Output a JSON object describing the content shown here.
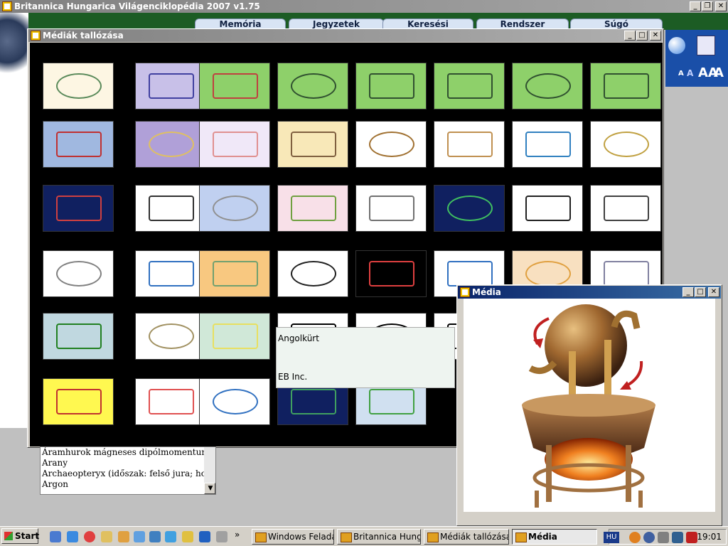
{
  "app": {
    "title": "Britannica Hungarica Világenciklopédia 2007 v1.75",
    "menu": [
      "Memória",
      "Jegyzetek",
      "Keresési beállítások",
      "Rendszer",
      "Súgó"
    ],
    "font_buttons": [
      "A",
      "A",
      "AA",
      "A"
    ]
  },
  "browser_window": {
    "title": "Médiák tallózása",
    "tooltip": {
      "name": "Angolkürt",
      "credit": "EB Inc."
    }
  },
  "thumbnails": [
    {
      "bg": "#fdf6e3",
      "mark": "#5a8a5a"
    },
    {
      "bg": "#c8c0e8",
      "mark": "#4040a0"
    },
    {
      "bg": "#8ed06a",
      "mark": "#c04040"
    },
    {
      "bg": "#8ed06a",
      "mark": "#305030"
    },
    {
      "bg": "#8ed06a",
      "mark": "#305030"
    },
    {
      "bg": "#8ed06a",
      "mark": "#305030"
    },
    {
      "bg": "#8ed06a",
      "mark": "#305030"
    },
    {
      "bg": "#8ed06a",
      "mark": "#305030"
    },
    {
      "bg": "#a0b8e0",
      "mark": "#c03030"
    },
    {
      "bg": "#b0a0d8",
      "mark": "#e0c060"
    },
    {
      "bg": "#f0e8f8",
      "mark": "#e09090"
    },
    {
      "bg": "#f8e8b8",
      "mark": "#806040"
    },
    {
      "bg": "#ffffff",
      "mark": "#a07030"
    },
    {
      "bg": "#ffffff",
      "mark": "#c09050"
    },
    {
      "bg": "#ffffff",
      "mark": "#3080c0"
    },
    {
      "bg": "#ffffff",
      "mark": "#c0a040"
    },
    {
      "bg": "#102060",
      "mark": "#d04040"
    },
    {
      "bg": "#ffffff",
      "mark": "#303030"
    },
    {
      "bg": "#c0d0f0",
      "mark": "#909090"
    },
    {
      "bg": "#f8e0e8",
      "mark": "#70a040"
    },
    {
      "bg": "#ffffff",
      "mark": "#707070"
    },
    {
      "bg": "#102060",
      "mark": "#40c060"
    },
    {
      "bg": "#ffffff",
      "mark": "#202020"
    },
    {
      "bg": "#ffffff",
      "mark": "#404040"
    },
    {
      "bg": "#ffffff",
      "mark": "#808080"
    },
    {
      "bg": "#ffffff",
      "mark": "#3070c0"
    },
    {
      "bg": "#f8c880",
      "mark": "#70a070"
    },
    {
      "bg": "#ffffff",
      "mark": "#202020"
    },
    {
      "bg": "#000000",
      "mark": "#e04040"
    },
    {
      "bg": "#ffffff",
      "mark": "#3070c0"
    },
    {
      "bg": "#f8e0c0",
      "mark": "#e0a040"
    },
    {
      "bg": "#ffffff",
      "mark": "#8080a0"
    },
    {
      "bg": "#c0d8e0",
      "mark": "#208020"
    },
    {
      "bg": "#ffffff",
      "mark": "#a09060"
    },
    {
      "bg": "#d0e8d8",
      "mark": "#e8e060"
    },
    {
      "bg": "#ffffff",
      "mark": "#000000"
    },
    {
      "bg": "#ffffff",
      "mark": "#000000"
    },
    {
      "bg": "#ffffff",
      "mark": "#000000"
    },
    {
      "bg": "#ffffff",
      "mark": "#000000"
    },
    {
      "bg": "#ffffff",
      "mark": "#000000"
    },
    {
      "bg": "#fff850",
      "mark": "#c03030"
    },
    {
      "bg": "#ffffff",
      "mark": "#e05050"
    },
    {
      "bg": "#ffffff",
      "mark": "#3070c0"
    },
    {
      "bg": "#102060",
      "mark": "#40a060"
    },
    {
      "bg": "#d0e0f0",
      "mark": "#40a040"
    }
  ],
  "list_items": [
    "Áramhurok mágneses dipólmomentuma, an",
    "Arany",
    "Archaeopteryx (időszak: felső jura; hossza:",
    "Argon"
  ],
  "media_window": {
    "title": "Média"
  },
  "taskbar": {
    "start": "Start",
    "tasks": [
      "Windows Felada...",
      "Britannica Hung...",
      "Médiák tallózása",
      "Média"
    ],
    "lang": "HU",
    "clock": "19:01"
  }
}
